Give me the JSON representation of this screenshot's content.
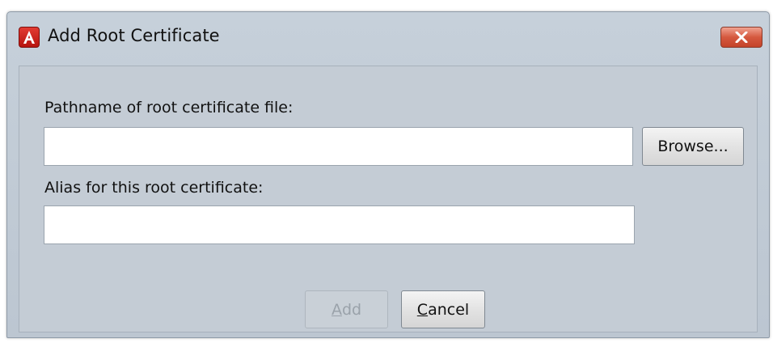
{
  "window": {
    "title": "Add Root Certificate",
    "app_icon": "acrobat-icon",
    "close_icon": "close-icon"
  },
  "form": {
    "pathname_label": "Pathname of root certificate file:",
    "pathname_value": "",
    "browse_label": "Browse...",
    "alias_label": "Alias for this root certificate:",
    "alias_value": ""
  },
  "buttons": {
    "add_label": "Add",
    "add_mnemonic": "A",
    "add_rest": "dd",
    "add_enabled": false,
    "cancel_label": "Cancel",
    "cancel_mnemonic": "C",
    "cancel_rest": "ancel"
  },
  "colors": {
    "close_button": "#d5593f",
    "app_icon": "#c81e17",
    "dialog_background": "#c4ccd5"
  }
}
